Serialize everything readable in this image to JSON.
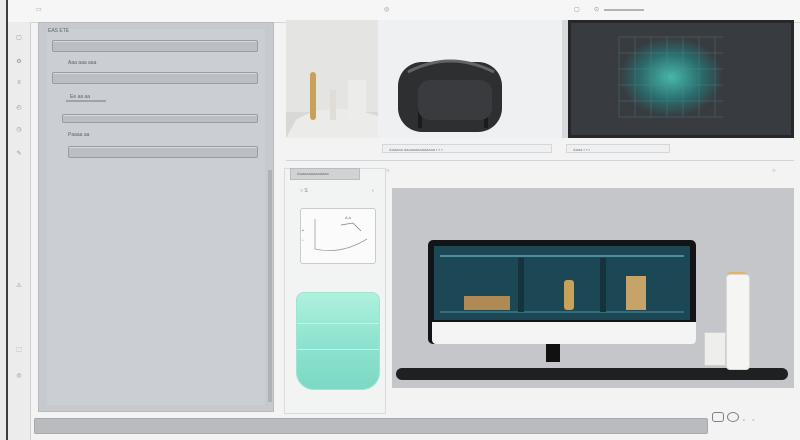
{
  "topbar": {
    "left_text": "▭",
    "mid_glyph": "◎",
    "right_glyph_1": "▢",
    "right_glyph_2": "⊙"
  },
  "sidebar": {
    "icons": [
      "▢",
      "⚙",
      "≡",
      "◴",
      "◷",
      "✎",
      "⚠",
      "⬚",
      "◎"
    ]
  },
  "left_panel": {
    "title": "EAS ETE",
    "row_labels": [
      "Aaa aaa aaa",
      "Ee aa aa",
      "Paaaa aa"
    ],
    "row_prefix_glyph": [
      "ℹ",
      "ℹ",
      "ℹ"
    ]
  },
  "thumbs": {
    "captions": [
      "Aaaaaa aaaaaaaaaaaaaa  ▪ ▪ ▪",
      "Aaaa  ▪ ▪ ▪"
    ]
  },
  "middle": {
    "header_label": "Aaaaaaaaaaaaaa",
    "small_row": "○ S",
    "preview_annotation": "A a"
  },
  "bottom": {
    "icons": [
      "▢",
      "◯",
      "▫",
      "▫"
    ]
  },
  "colors": {
    "teal_accent": "#8de2cd",
    "screen": "#1d4a57",
    "thumb_dark": "#383b40",
    "gold": "#c9a25a"
  }
}
